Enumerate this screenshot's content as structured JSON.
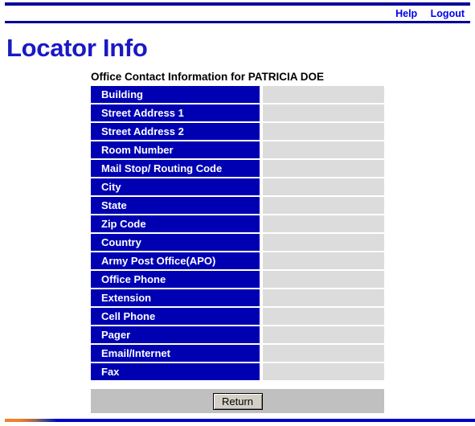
{
  "nav": {
    "links": [
      {
        "label": "Help",
        "name": "help-link"
      },
      {
        "label": "Logout",
        "name": "logout-link"
      }
    ]
  },
  "page": {
    "title": "Locator Info",
    "section_heading": "Office Contact Information for PATRICIA DOE"
  },
  "info_table": {
    "rows": [
      {
        "label": "Building",
        "value": ""
      },
      {
        "label": "Street Address 1",
        "value": ""
      },
      {
        "label": "Street Address 2",
        "value": ""
      },
      {
        "label": "Room Number",
        "value": ""
      },
      {
        "label": "Mail Stop/ Routing Code",
        "value": ""
      },
      {
        "label": "City",
        "value": ""
      },
      {
        "label": "State",
        "value": ""
      },
      {
        "label": "Zip Code",
        "value": ""
      },
      {
        "label": "Country",
        "value": ""
      },
      {
        "label": "Army Post Office(APO)",
        "value": ""
      },
      {
        "label": "Office Phone",
        "value": ""
      },
      {
        "label": "Extension",
        "value": ""
      },
      {
        "label": "Cell Phone",
        "value": ""
      },
      {
        "label": "Pager",
        "value": ""
      },
      {
        "label": "Email/Internet",
        "value": ""
      },
      {
        "label": "Fax",
        "value": ""
      }
    ]
  },
  "actions": {
    "return_label": "Return"
  },
  "colors": {
    "label_blue": "#0000b3",
    "rule_navy": "#000099",
    "value_gray": "#dcdcdc",
    "action_bar_gray": "#c0c0c0",
    "title_blue": "#1a19c4",
    "link_blue": "#0000ee",
    "accent_orange": "#f2802c"
  }
}
